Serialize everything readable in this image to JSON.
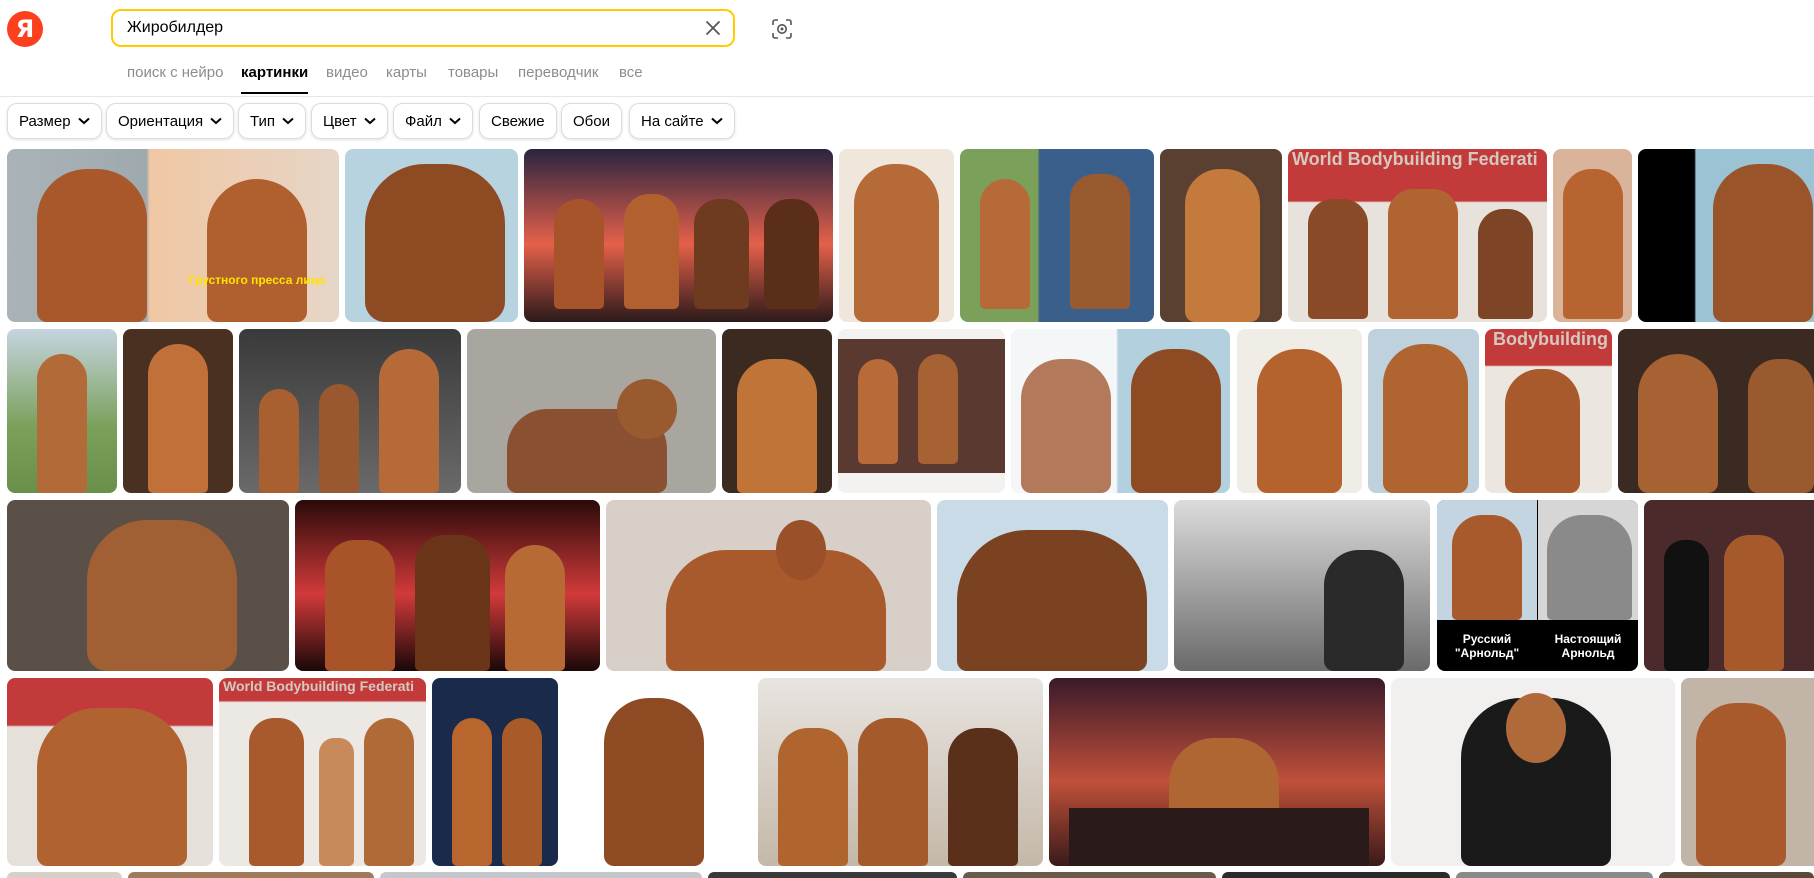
{
  "header": {
    "logo_letter": "Я",
    "search_value": "Жиробилдер",
    "tabs": [
      {
        "label": "поиск с нейро"
      },
      {
        "label": "картинки"
      },
      {
        "label": "видео"
      },
      {
        "label": "карты"
      },
      {
        "label": "товары"
      },
      {
        "label": "переводчик"
      },
      {
        "label": "все"
      }
    ],
    "active_tab": "картинки"
  },
  "filters": [
    {
      "label": "Размер",
      "dropdown": true
    },
    {
      "label": "Ориентация",
      "dropdown": true
    },
    {
      "label": "Тип",
      "dropdown": true
    },
    {
      "label": "Цвет",
      "dropdown": true
    },
    {
      "label": "Файл",
      "dropdown": true
    },
    {
      "label": "Свежие",
      "dropdown": false
    },
    {
      "label": "Обои",
      "dropdown": false
    },
    {
      "label": "На сайте",
      "dropdown": true
    }
  ],
  "image_texts": {
    "caption_1": "Грустного пресса лицо",
    "overlay_federation": "World Bodybuilding Federati",
    "overlay_bodybuilding": "Bodybuilding",
    "overlay_federation_2": "World Bodybuilding Federati",
    "compare_left": "Русский\n\"Арнольд\"",
    "compare_right": "Настоящий\nАрнольд"
  },
  "colors": {
    "accent_yellow": "#ffcc00",
    "logo_red": "#fc3f1d",
    "muted_text": "#8c8c8c"
  }
}
